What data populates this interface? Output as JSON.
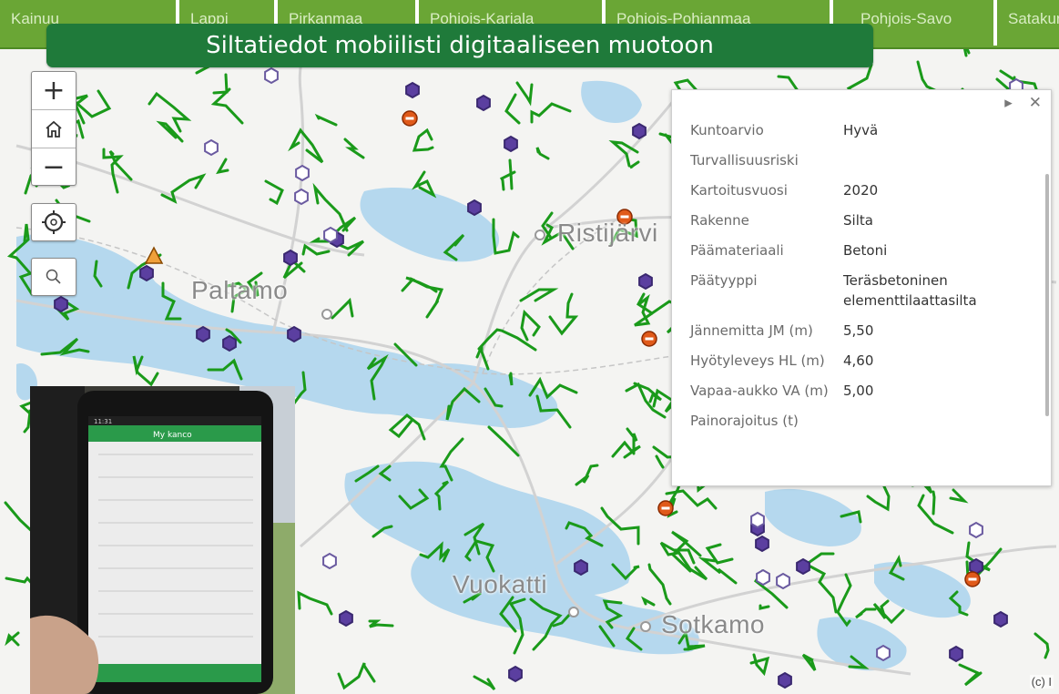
{
  "tabs": [
    "Kainuu",
    "Lappi",
    "Pirkanmaa",
    "Pohjois-Karjala",
    "Pohjois-Pohjanmaa",
    "Pohjois-Savo",
    "Satakunta"
  ],
  "banner_title": "Siltatiedot mobiilisti digitaaliseen muotoon",
  "map": {
    "zoom_in_label": "+",
    "zoom_out_label": "−",
    "place_names": [
      "Ristijärvi",
      "Paltamo",
      "Vuokatti",
      "Sotkamo"
    ],
    "credit": "(c) I",
    "colors": {
      "river": "#1a9a1a",
      "lake": "#b5d8ee",
      "road": "#d0d0d0",
      "bridge": "#5b3fa0",
      "closed": "#e05a1a",
      "warning": "#f0a03a"
    }
  },
  "popup": {
    "fields": [
      {
        "k": "Kuntoarvio",
        "v": "Hyvä"
      },
      {
        "k": "Turvallisuusriski",
        "v": ""
      },
      {
        "k": "Kartoitusvuosi",
        "v": "2020"
      },
      {
        "k": "Rakenne",
        "v": "Silta"
      },
      {
        "k": "Päämateriaali",
        "v": "Betoni"
      },
      {
        "k": "Päätyyppi",
        "v": "Teräsbetoninen elementtilaattasilta"
      },
      {
        "k": "Jännemitta JM (m)",
        "v": "5,50"
      },
      {
        "k": "Hyötyleveys HL (m)",
        "v": "4,60"
      },
      {
        "k": "Vapaa-aukko VA (m)",
        "v": "5,00"
      },
      {
        "k": "Painorajoitus (t)",
        "v": ""
      }
    ]
  },
  "phone": {
    "app_title": "My kanco",
    "time": "11:31"
  }
}
